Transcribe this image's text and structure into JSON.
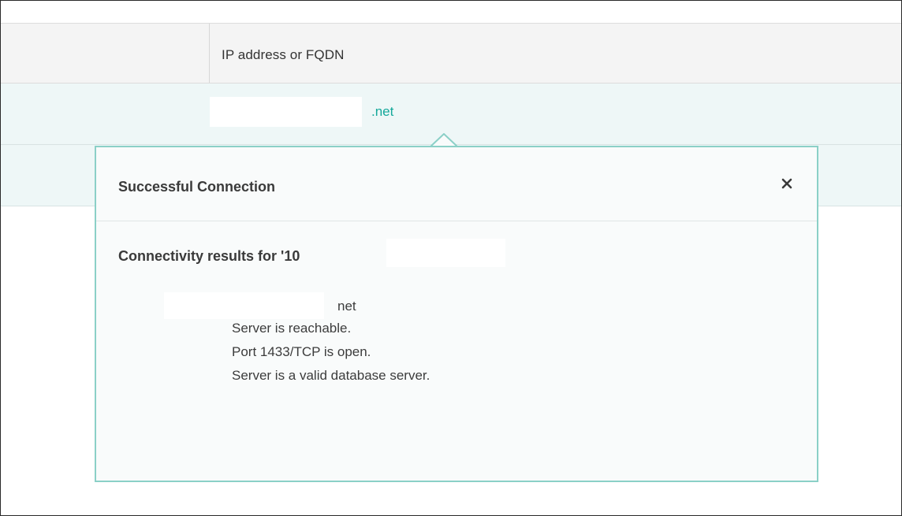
{
  "table": {
    "column_header": "IP address or FQDN",
    "row1_host_suffix": ".net"
  },
  "popover": {
    "title": "Successful Connection",
    "close_glyph": "×",
    "close_icon": "close-icon",
    "results_heading": "Connectivity results for '10",
    "host_suffix": "net",
    "lines": [
      "Server is reachable.",
      "Port 1433/TCP is open.",
      "Server is a valid database server."
    ]
  },
  "colors": {
    "accent": "#14a89a",
    "popover_border": "#8bd0c7",
    "row_highlight": "#eef7f7",
    "header_bg": "#f4f4f4"
  }
}
